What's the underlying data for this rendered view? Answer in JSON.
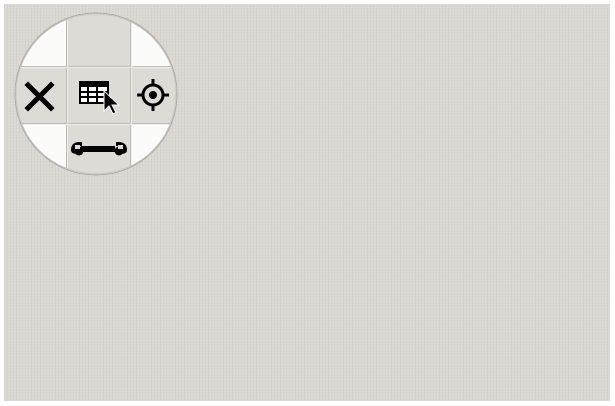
{
  "desktop": {
    "background_color": "#d9d8d2"
  },
  "radial_menu": {
    "ring_color": "#fcfcfa",
    "cell_color": "#dcdbd5",
    "icon_color": "#000000",
    "items": [
      {
        "id": "top",
        "icon": "empty-slot"
      },
      {
        "id": "left",
        "icon": "close-icon"
      },
      {
        "id": "center",
        "icon": "select-table-cursor-icon"
      },
      {
        "id": "right",
        "icon": "crosshair-target-icon"
      },
      {
        "id": "bottom",
        "icon": "wrench-icon"
      }
    ]
  }
}
